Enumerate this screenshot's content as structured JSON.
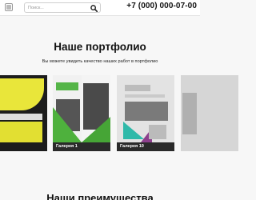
{
  "header": {
    "search_placeholder": "Поиск...",
    "phone": "+7 (000) 000-07-00"
  },
  "portfolio": {
    "title": "Наше портфолио",
    "subtitle": "Вы можете увидеть качество наших работ в портфолио",
    "cards": [
      {
        "caption": ""
      },
      {
        "caption": "Галерея 1"
      },
      {
        "caption": "Галерея 10"
      },
      {
        "caption": ""
      }
    ]
  },
  "next_section": {
    "title": "Наши преимущества"
  },
  "colors": {
    "page_bg": "#f7f7f7",
    "caption_bg": "#2a2a2a",
    "brochure_green": "#4eb13d",
    "brochure_yellow": "#e9e63a",
    "brochure_teal": "#2fb9a9"
  },
  "icons": {
    "logo": "logo-icon",
    "search": "search-icon"
  }
}
